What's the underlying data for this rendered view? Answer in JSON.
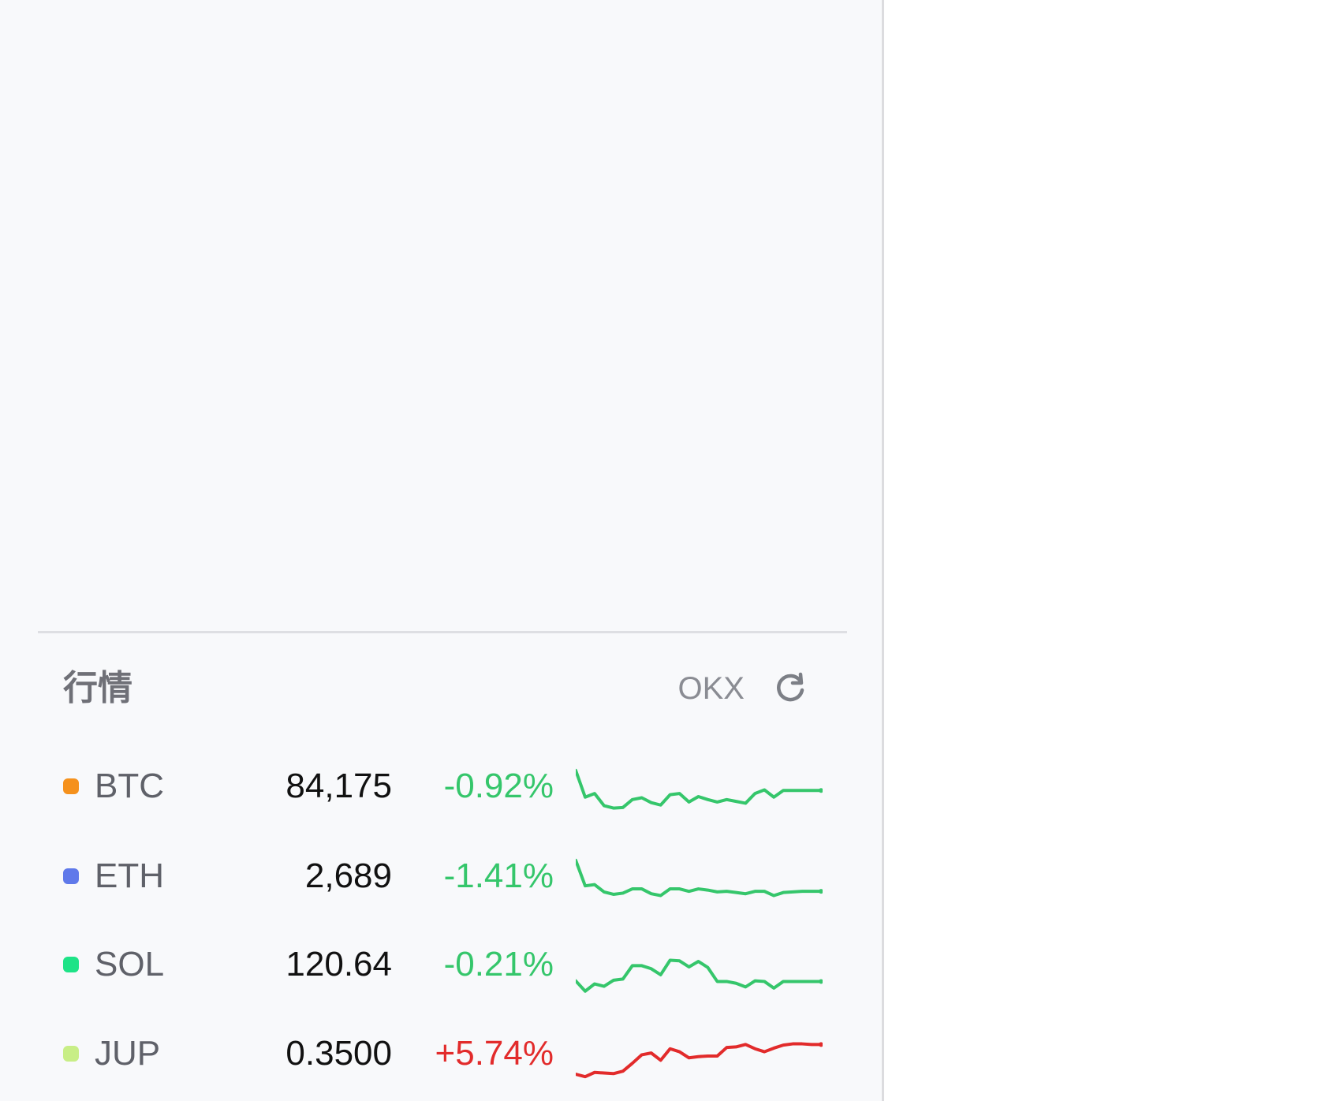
{
  "market": {
    "title": "行情",
    "source": "OKX",
    "refresh_icon": "refresh-icon",
    "colors": {
      "down": "#35c66b",
      "up": "#e22b2b"
    },
    "tickers": [
      {
        "symbol": "BTC",
        "price": "84,175",
        "change": "-0.92%",
        "direction": "down",
        "dot_color": "#f5911c",
        "trend": [
          82,
          38,
          44,
          24,
          20,
          21,
          34,
          37,
          29,
          25,
          42,
          44,
          30,
          39,
          34,
          30,
          34,
          31,
          28,
          44,
          50,
          38,
          49,
          49,
          49,
          49,
          49
        ]
      },
      {
        "symbol": "ETH",
        "price": "2,689",
        "change": "-1.41%",
        "direction": "down",
        "dot_color": "#5f79ea",
        "trend": [
          82,
          40,
          42,
          30,
          26,
          28,
          35,
          35,
          27,
          24,
          35,
          35,
          31,
          35,
          33,
          30,
          31,
          29,
          27,
          31,
          31,
          24,
          29,
          30,
          31,
          31,
          31
        ]
      },
      {
        "symbol": "SOL",
        "price": "120.64",
        "change": "-0.21%",
        "direction": "down",
        "dot_color": "#1ee387",
        "trend": [
          29,
          12,
          24,
          20,
          30,
          32,
          54,
          54,
          49,
          39,
          63,
          62,
          52,
          61,
          51,
          28,
          28,
          25,
          19,
          29,
          28,
          17,
          28,
          28,
          28,
          28,
          28
        ]
      },
      {
        "symbol": "JUP",
        "price": "0.3500",
        "change": "+5.74%",
        "direction": "up",
        "dot_color": "#c8ee86",
        "trend": [
          22,
          18,
          25,
          24,
          23,
          27,
          40,
          54,
          57,
          45,
          64,
          59,
          49,
          51,
          52,
          52,
          66,
          67,
          71,
          64,
          59,
          65,
          70,
          72,
          72,
          71,
          71
        ]
      }
    ]
  }
}
